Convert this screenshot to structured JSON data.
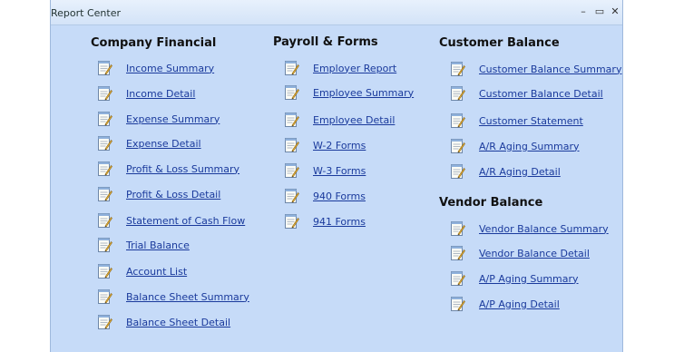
{
  "window": {
    "title": "Report Center",
    "controls": {
      "minimize": "–",
      "maximize": "▭",
      "close": "✕"
    }
  },
  "sections": {
    "company_financial": {
      "title": "Company Financial",
      "items": [
        "Income Summary",
        "Income Detail",
        "Expense Summary",
        "Expense Detail",
        "Profit & Loss Summary",
        "Profit & Loss Detail",
        "Statement of Cash Flow",
        "Trial Balance",
        "Account List",
        "Balance Sheet Summary",
        "Balance Sheet Detail"
      ]
    },
    "payroll_forms": {
      "title": "Payroll & Forms",
      "items": [
        "Employer Report",
        "Employee Summary",
        "Employee Detail",
        "W-2 Forms",
        "W-3 Forms",
        "940 Forms",
        "941 Forms"
      ]
    },
    "customer_balance": {
      "title": "Customer Balance",
      "items": [
        "Customer Balance Summary",
        "Customer Balance Detail",
        "Customer Statement",
        "A/R Aging Summary",
        "A/R Aging Detail"
      ]
    },
    "vendor_balance": {
      "title": "Vendor Balance",
      "items": [
        "Vendor Balance Summary",
        "Vendor Balance Detail",
        "A/P Aging Summary",
        "A/P Aging Detail"
      ]
    }
  }
}
